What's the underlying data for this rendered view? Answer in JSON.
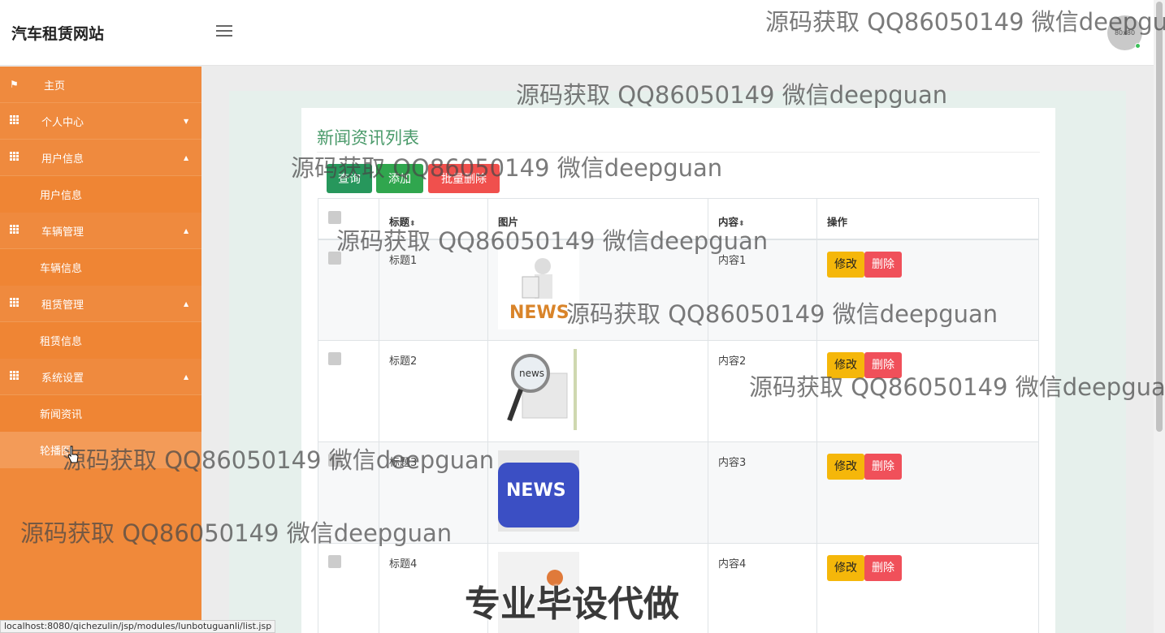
{
  "header": {
    "brand": "汽车租赁网站",
    "avatar_text": "80x80"
  },
  "sidebar": {
    "items": [
      {
        "label": "主页",
        "type": "top",
        "icon": "flag-icon"
      },
      {
        "label": "个人中心",
        "type": "top",
        "icon": "grid-icon",
        "caret": "▼"
      },
      {
        "label": "用户信息",
        "type": "top",
        "icon": "grid-icon",
        "caret": "▲"
      },
      {
        "label": "用户信息",
        "type": "sub"
      },
      {
        "label": "车辆管理",
        "type": "top",
        "icon": "grid-icon",
        "caret": "▲"
      },
      {
        "label": "车辆信息",
        "type": "sub"
      },
      {
        "label": "租赁管理",
        "type": "top",
        "icon": "grid-icon",
        "caret": "▲"
      },
      {
        "label": "租赁信息",
        "type": "sub"
      },
      {
        "label": "系统设置",
        "type": "top",
        "icon": "grid-icon",
        "caret": "▲"
      },
      {
        "label": "新闻资讯",
        "type": "sub"
      },
      {
        "label": "轮播图",
        "type": "sub"
      }
    ]
  },
  "main": {
    "title": "新闻资讯列表",
    "buttons": {
      "query": "查询",
      "add": "添加",
      "batch_delete": "批量删除"
    },
    "table": {
      "headers": {
        "title": "标题",
        "image": "图片",
        "content": "内容",
        "action": "操作"
      },
      "sort_icon": "⬍",
      "rows": [
        {
          "title": "标题1",
          "content": "内容1",
          "image_label": "NEWS"
        },
        {
          "title": "标题2",
          "content": "内容2",
          "image_label": "news"
        },
        {
          "title": "标题3",
          "content": "内容3",
          "image_label": "NEWS"
        },
        {
          "title": "标题4",
          "content": "内容4",
          "image_label": ""
        }
      ],
      "edit_label": "修改",
      "delete_label": "删除"
    }
  },
  "watermark": {
    "text": "源码获取 QQ86050149 微信deepguan",
    "big": "专业毕设代做"
  },
  "statusbar": "localhost:8080/qichezulin/jsp/modules/lunbotuguanli/list.jsp"
}
